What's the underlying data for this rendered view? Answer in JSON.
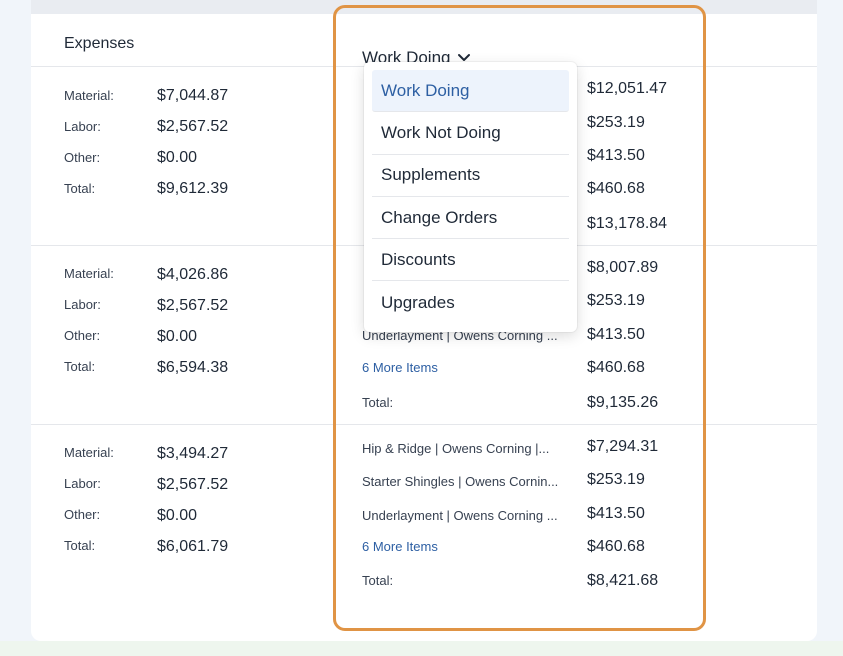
{
  "header": {
    "expenses_title": "Expenses",
    "dropdown_selected": "Work Doing"
  },
  "dropdown_menu": {
    "items": [
      "Work Doing",
      "Work Not Doing",
      "Supplements",
      "Change Orders",
      "Discounts",
      "Upgrades"
    ],
    "active_index": 0
  },
  "rows": [
    {
      "expenses": [
        {
          "label": "Material:",
          "value": "$7,044.87"
        },
        {
          "label": "Labor:",
          "value": "$2,567.52"
        },
        {
          "label": "Other:",
          "value": "$0.00"
        },
        {
          "label": "Total:",
          "value": "$9,612.39"
        }
      ],
      "items": [
        {
          "label": "",
          "value": "$12,051.47"
        },
        {
          "label": "",
          "value": "$253.19"
        },
        {
          "label": "",
          "value": "$413.50"
        },
        {
          "label": "",
          "value": "$460.68"
        },
        {
          "label": "",
          "value": "$13,178.84"
        }
      ]
    },
    {
      "expenses": [
        {
          "label": "Material:",
          "value": "$4,026.86"
        },
        {
          "label": "Labor:",
          "value": "$2,567.52"
        },
        {
          "label": "Other:",
          "value": "$0.00"
        },
        {
          "label": "Total:",
          "value": "$6,594.38"
        }
      ],
      "items": [
        {
          "label": "",
          "value": "$8,007.89"
        },
        {
          "label": "",
          "value": "$253.19"
        },
        {
          "label": "Underlayment | Owens Corning ...",
          "value": "$413.50"
        },
        {
          "label": "6 More Items",
          "value": "$460.68"
        },
        {
          "label": "Total:",
          "value": "$9,135.26"
        }
      ]
    },
    {
      "expenses": [
        {
          "label": "Material:",
          "value": "$3,494.27"
        },
        {
          "label": "Labor:",
          "value": "$2,567.52"
        },
        {
          "label": "Other:",
          "value": "$0.00"
        },
        {
          "label": "Total:",
          "value": "$6,061.79"
        }
      ],
      "items": [
        {
          "label": "Hip & Ridge | Owens Corning |...",
          "value": "$7,294.31"
        },
        {
          "label": "Starter Shingles | Owens Cornin...",
          "value": "$253.19"
        },
        {
          "label": "Underlayment | Owens Corning ...",
          "value": "$413.50"
        },
        {
          "label": "6 More Items",
          "value": "$460.68"
        },
        {
          "label": "Total:",
          "value": "$8,421.68"
        }
      ]
    }
  ],
  "colors": {
    "accent": "#2d5fa3",
    "highlight_border": "#e09445",
    "active_item_bg": "#edf3fc"
  },
  "icons": {
    "dropdown": "chevron-down-icon"
  }
}
